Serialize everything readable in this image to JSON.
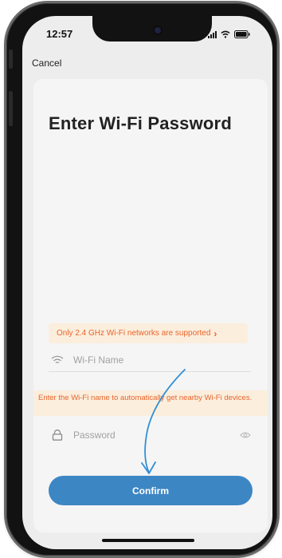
{
  "status_bar": {
    "time": "12:57",
    "icons": [
      "signal-icon",
      "wifi-icon",
      "battery-icon"
    ]
  },
  "nav": {
    "cancel_label": "Cancel"
  },
  "page": {
    "title": "Enter Wi-Fi Password"
  },
  "notice": {
    "text": "Only 2.4 GHz Wi-Fi networks are supported",
    "chevron": "›"
  },
  "wifi_field": {
    "placeholder": "Wi-Fi Name",
    "value": ""
  },
  "hint": {
    "text": "Enter the Wi-Fi name to automatically get nearby Wi-Fi devices."
  },
  "password_field": {
    "placeholder": "Password",
    "value": ""
  },
  "confirm": {
    "label": "Confirm"
  },
  "colors": {
    "accent": "#3d86c4",
    "warning_text": "#e9642b",
    "warning_bg": "#fbeedd",
    "annotation_arrow": "#2f8fd6"
  }
}
